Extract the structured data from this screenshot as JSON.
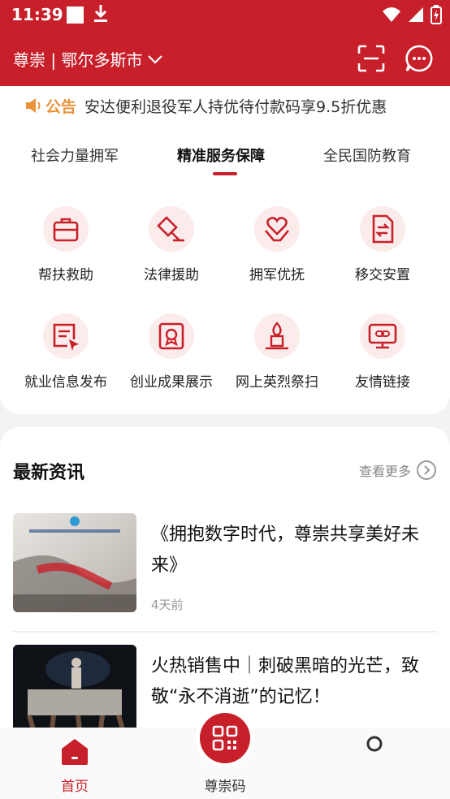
{
  "status_bar": {
    "time": "11:39"
  },
  "app_bar": {
    "location": "尊崇 | 鄂尔多斯市"
  },
  "notice": {
    "tag": "公告",
    "text": "安达便利退役军人持优待付款码享9.5折优惠"
  },
  "tabs": [
    {
      "label": "社会力量拥军"
    },
    {
      "label": "精准服务保障"
    },
    {
      "label": "全民国防教育"
    }
  ],
  "services": [
    {
      "label": "帮扶救助",
      "icon": "briefcase-icon"
    },
    {
      "label": "法律援助",
      "icon": "gavel-icon"
    },
    {
      "label": "拥军优抚",
      "icon": "heart-hand-icon"
    },
    {
      "label": "移交安置",
      "icon": "transfer-document-icon"
    },
    {
      "label": "就业信息发布",
      "icon": "job-board-icon"
    },
    {
      "label": "创业成果展示",
      "icon": "certificate-icon"
    },
    {
      "label": "网上英烈祭扫",
      "icon": "memorial-flame-icon"
    },
    {
      "label": "友情链接",
      "icon": "link-monitor-icon"
    }
  ],
  "news": {
    "heading": "最新资讯",
    "more_label": "查看更多",
    "items": [
      {
        "title": "《拥抱数字时代，尊崇共享美好未来》",
        "date": "4天前"
      },
      {
        "title": "火热销售中｜刺破黑暗的光芒，致敬“永不消逝”的记忆！",
        "date": ""
      }
    ]
  },
  "bottom_nav": [
    {
      "label": "首页",
      "icon": "home-icon"
    },
    {
      "label": "尊崇码",
      "icon": "qr-code-icon"
    },
    {
      "label": "",
      "icon": "circle-icon"
    }
  ],
  "colors": {
    "primary": "#c8202b",
    "notice_orange": "#e8923a",
    "icon_bg": "#fbeceb"
  }
}
